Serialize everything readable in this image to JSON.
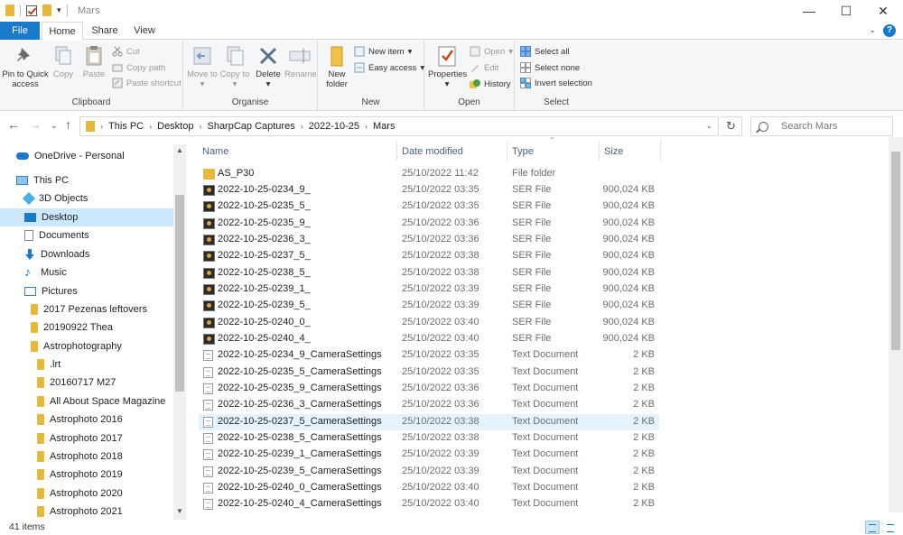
{
  "window": {
    "title": "Mars",
    "min_icon": "minimize-icon",
    "max_icon": "maximize-icon",
    "close_icon": "close-icon"
  },
  "ribbon_tabs": {
    "file": "File",
    "home": "Home",
    "share": "Share",
    "view": "View"
  },
  "ribbon": {
    "clipboard": {
      "label": "Clipboard",
      "pin": "Pin to Quick access",
      "copy": "Copy",
      "paste": "Paste",
      "cut": "Cut",
      "copy_path": "Copy path",
      "paste_shortcut": "Paste shortcut"
    },
    "organise": {
      "label": "Organise",
      "move_to": "Move to",
      "copy_to": "Copy to",
      "delete": "Delete",
      "rename": "Rename"
    },
    "new": {
      "label": "New",
      "new_folder": "New folder",
      "new_item": "New item",
      "easy_access": "Easy access"
    },
    "open": {
      "label": "Open",
      "properties": "Properties",
      "open": "Open",
      "edit": "Edit",
      "history": "History"
    },
    "select": {
      "label": "Select",
      "select_all": "Select all",
      "select_none": "Select none",
      "invert": "Invert selection"
    }
  },
  "address": {
    "crumbs": [
      "This PC",
      "Desktop",
      "SharpCap Captures",
      "2022-10-25",
      "Mars"
    ],
    "search_placeholder": "Search Mars"
  },
  "nav_pane": {
    "items": [
      {
        "label": "OneDrive - Personal",
        "icon": "cloud"
      },
      {
        "label": "This PC",
        "icon": "pc"
      },
      {
        "label": "3D Objects",
        "icon": "box3d"
      },
      {
        "label": "Desktop",
        "icon": "desk"
      },
      {
        "label": "Documents",
        "icon": "docs"
      },
      {
        "label": "Downloads",
        "icon": "dl"
      },
      {
        "label": "Music",
        "icon": "music"
      },
      {
        "label": "Pictures",
        "icon": "pics"
      },
      {
        "label": "2017 Pezenas leftovers",
        "icon": "folder"
      },
      {
        "label": "20190922 Thea",
        "icon": "folder"
      },
      {
        "label": "Astrophotography",
        "icon": "folder"
      },
      {
        "label": ".lrt",
        "icon": "folder"
      },
      {
        "label": "20160717 M27",
        "icon": "folder"
      },
      {
        "label": "All About Space Magazine",
        "icon": "folder"
      },
      {
        "label": "Astrophoto 2016",
        "icon": "folder"
      },
      {
        "label": "Astrophoto 2017",
        "icon": "folder"
      },
      {
        "label": "Astrophoto 2018",
        "icon": "folder"
      },
      {
        "label": "Astrophoto 2019",
        "icon": "folder"
      },
      {
        "label": "Astrophoto 2020",
        "icon": "folder"
      },
      {
        "label": "Astrophoto 2021",
        "icon": "folder"
      }
    ]
  },
  "file_list": {
    "columns": {
      "name": "Name",
      "date": "Date modified",
      "type": "Type",
      "size": "Size"
    },
    "rows": [
      {
        "name": "AS_P30",
        "date": "25/10/2022 11:42",
        "type": "File folder",
        "size": "",
        "icon": "folder"
      },
      {
        "name": "2022-10-25-0234_9_",
        "date": "25/10/2022 03:35",
        "type": "SER File",
        "size": "900,024 KB",
        "icon": "ser"
      },
      {
        "name": "2022-10-25-0235_5_",
        "date": "25/10/2022 03:35",
        "type": "SER File",
        "size": "900,024 KB",
        "icon": "ser"
      },
      {
        "name": "2022-10-25-0235_9_",
        "date": "25/10/2022 03:36",
        "type": "SER File",
        "size": "900,024 KB",
        "icon": "ser"
      },
      {
        "name": "2022-10-25-0236_3_",
        "date": "25/10/2022 03:36",
        "type": "SER File",
        "size": "900,024 KB",
        "icon": "ser"
      },
      {
        "name": "2022-10-25-0237_5_",
        "date": "25/10/2022 03:38",
        "type": "SER File",
        "size": "900,024 KB",
        "icon": "ser"
      },
      {
        "name": "2022-10-25-0238_5_",
        "date": "25/10/2022 03:38",
        "type": "SER File",
        "size": "900,024 KB",
        "icon": "ser"
      },
      {
        "name": "2022-10-25-0239_1_",
        "date": "25/10/2022 03:39",
        "type": "SER File",
        "size": "900,024 KB",
        "icon": "ser"
      },
      {
        "name": "2022-10-25-0239_5_",
        "date": "25/10/2022 03:39",
        "type": "SER File",
        "size": "900,024 KB",
        "icon": "ser"
      },
      {
        "name": "2022-10-25-0240_0_",
        "date": "25/10/2022 03:40",
        "type": "SER File",
        "size": "900,024 KB",
        "icon": "ser"
      },
      {
        "name": "2022-10-25-0240_4_",
        "date": "25/10/2022 03:40",
        "type": "SER File",
        "size": "900,024 KB",
        "icon": "ser"
      },
      {
        "name": "2022-10-25-0234_9_CameraSettings",
        "date": "25/10/2022 03:35",
        "type": "Text Document",
        "size": "2 KB",
        "icon": "txt"
      },
      {
        "name": "2022-10-25-0235_5_CameraSettings",
        "date": "25/10/2022 03:35",
        "type": "Text Document",
        "size": "2 KB",
        "icon": "txt"
      },
      {
        "name": "2022-10-25-0235_9_CameraSettings",
        "date": "25/10/2022 03:36",
        "type": "Text Document",
        "size": "2 KB",
        "icon": "txt"
      },
      {
        "name": "2022-10-25-0236_3_CameraSettings",
        "date": "25/10/2022 03:36",
        "type": "Text Document",
        "size": "2 KB",
        "icon": "txt"
      },
      {
        "name": "2022-10-25-0237_5_CameraSettings",
        "date": "25/10/2022 03:38",
        "type": "Text Document",
        "size": "2 KB",
        "icon": "txt"
      },
      {
        "name": "2022-10-25-0238_5_CameraSettings",
        "date": "25/10/2022 03:38",
        "type": "Text Document",
        "size": "2 KB",
        "icon": "txt"
      },
      {
        "name": "2022-10-25-0239_1_CameraSettings",
        "date": "25/10/2022 03:39",
        "type": "Text Document",
        "size": "2 KB",
        "icon": "txt"
      },
      {
        "name": "2022-10-25-0239_5_CameraSettings",
        "date": "25/10/2022 03:39",
        "type": "Text Document",
        "size": "2 KB",
        "icon": "txt"
      },
      {
        "name": "2022-10-25-0240_0_CameraSettings",
        "date": "25/10/2022 03:40",
        "type": "Text Document",
        "size": "2 KB",
        "icon": "txt"
      },
      {
        "name": "2022-10-25-0240_4_CameraSettings",
        "date": "25/10/2022 03:40",
        "type": "Text Document",
        "size": "2 KB",
        "icon": "txt"
      }
    ]
  },
  "status": {
    "count": "41 items"
  },
  "colors": {
    "accent": "#1979ca",
    "selection": "#cce8ff",
    "hover": "#e5f3ff"
  }
}
